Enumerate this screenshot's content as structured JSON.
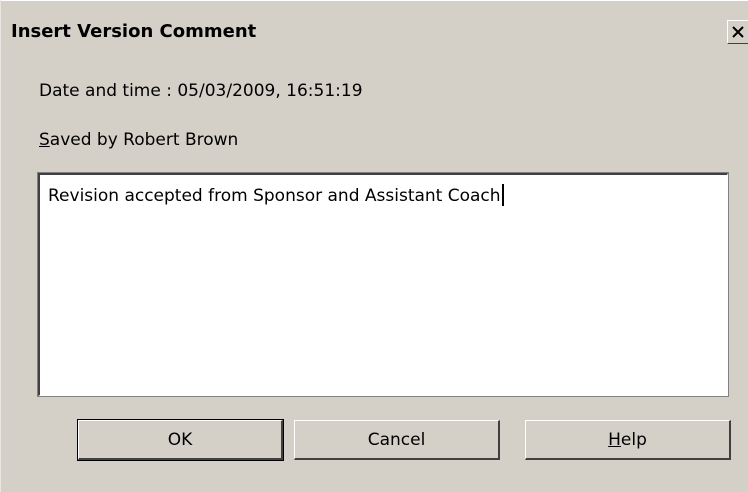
{
  "window": {
    "title": "Insert Version Comment",
    "close_icon": "close-icon"
  },
  "info": {
    "date_label": "Date and time : 05/03/2009, 16:51:19",
    "saved_by_mnemonic": "S",
    "saved_by_rest": "aved by Robert Brown"
  },
  "comment": {
    "value": "Revision accepted from Sponsor and Assistant Coach"
  },
  "buttons": {
    "ok_label": "OK",
    "cancel_label": "Cancel",
    "help_mnemonic": "H",
    "help_rest": "elp"
  },
  "colors": {
    "dialog_background": "#d4d0c8",
    "text_area_background": "#ffffff",
    "text": "#000000"
  }
}
